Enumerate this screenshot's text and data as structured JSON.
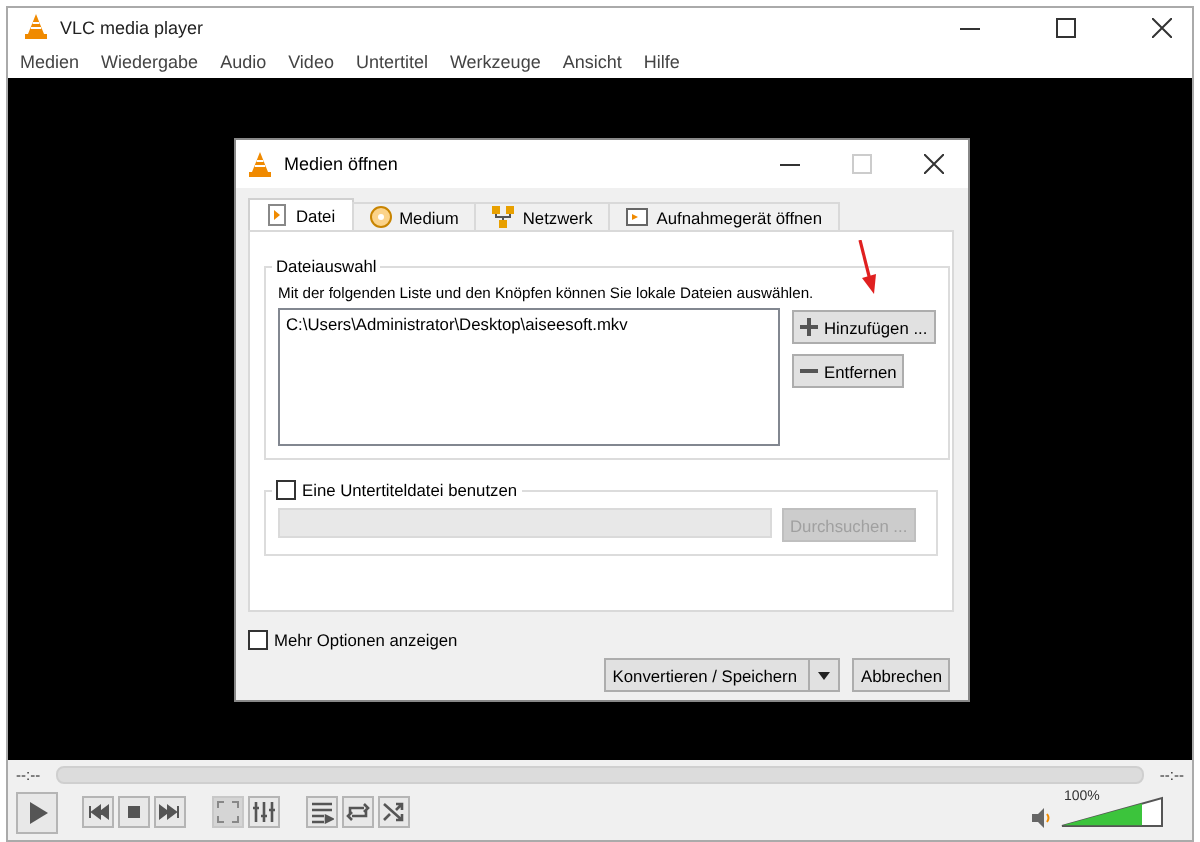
{
  "window": {
    "title": "VLC media player"
  },
  "menu": [
    "Medien",
    "Wiedergabe",
    "Audio",
    "Video",
    "Untertitel",
    "Werkzeuge",
    "Ansicht",
    "Hilfe"
  ],
  "dialog": {
    "title": "Medien öffnen",
    "tabs": [
      {
        "label": "Datei",
        "kind": "file",
        "selected": true
      },
      {
        "label": "Medium",
        "kind": "disc",
        "selected": false
      },
      {
        "label": "Netzwerk",
        "kind": "network",
        "selected": false
      },
      {
        "label": "Aufnahmegerät öffnen",
        "kind": "capture",
        "selected": false
      }
    ],
    "file_group": {
      "title": "Dateiauswahl",
      "description": "Mit der folgenden Liste und den Knöpfen können Sie lokale Dateien auswählen.",
      "files": [
        "C:\\Users\\Administrator\\Desktop\\aiseesoft.mkv"
      ],
      "add_button": "Hinzufügen ...",
      "remove_button": "Entfernen"
    },
    "subtitle": {
      "label": "Eine Untertiteldatei benutzen",
      "checked": false,
      "browse_button": "Durchsuchen ..."
    },
    "more_options": {
      "label": "Mehr Optionen anzeigen",
      "checked": false
    },
    "convert_button": "Konvertieren / Speichern",
    "cancel_button": "Abbrechen"
  },
  "player": {
    "time_elapsed": "--:--",
    "time_total": "--:--",
    "controls": [
      {
        "kind": "play",
        "disabled": false
      },
      {
        "kind": "previous",
        "disabled": false
      },
      {
        "kind": "stop",
        "disabled": false
      },
      {
        "kind": "next",
        "disabled": false
      },
      {
        "kind": "fullscreen",
        "disabled": true
      },
      {
        "kind": "extended",
        "disabled": false
      },
      {
        "kind": "playlist",
        "disabled": false
      },
      {
        "kind": "loop",
        "disabled": false
      },
      {
        "kind": "shuffle",
        "disabled": false
      }
    ],
    "volume": {
      "level": 0.8,
      "reading": "100%"
    }
  }
}
